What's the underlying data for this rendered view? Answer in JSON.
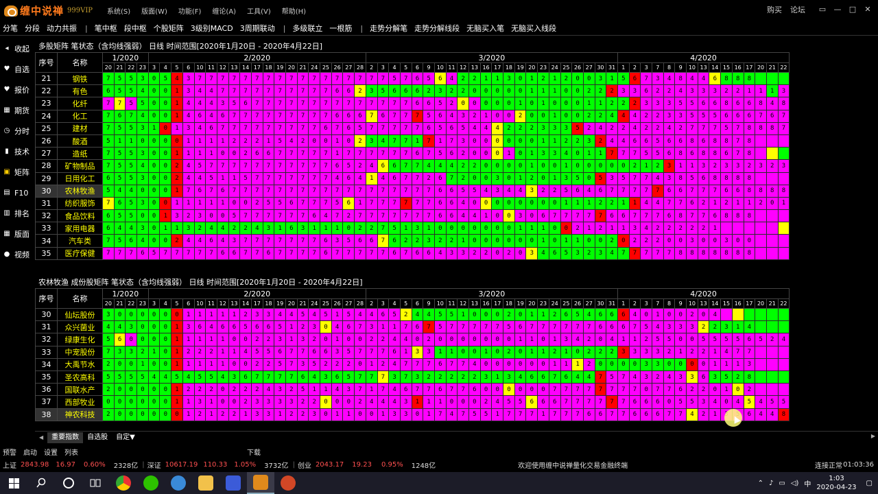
{
  "app": {
    "name": "缠中说禅",
    "edition": "999VIP",
    "menu": [
      "系统(S)",
      "版面(W)",
      "功能(F)",
      "缠论(A)",
      "工具(V)",
      "帮助(H)"
    ],
    "top_right": [
      "购买",
      "论坛"
    ],
    "window_buttons": [
      "▭",
      "—",
      "□",
      "✕"
    ]
  },
  "toolbar": {
    "items": [
      "分笔",
      "分段",
      "动力共振",
      "|",
      "笔中枢",
      "段中枢",
      "个股矩阵",
      "3级别MACD",
      "3周期联动",
      "|",
      "多级联立",
      "一根筋",
      "|",
      "走势分解笔",
      "走势分解线段",
      "无脑买入笔",
      "无脑买入线段"
    ]
  },
  "sidebar": {
    "items": [
      {
        "icon": "◂",
        "icon_name": "collapse-icon",
        "label": "收起"
      },
      {
        "icon": "♥",
        "icon_name": "favorite-icon",
        "label": "自选"
      },
      {
        "icon": "♥",
        "icon_name": "quote-icon",
        "label": "报价"
      },
      {
        "icon": "▦",
        "icon_name": "futures-icon",
        "label": "期货"
      },
      {
        "icon": "◷",
        "icon_name": "intraday-icon",
        "label": "分时"
      },
      {
        "icon": "▮",
        "icon_name": "technical-icon",
        "label": "技术"
      },
      {
        "icon": "▣",
        "icon_name": "matrix-icon",
        "label": "矩阵"
      },
      {
        "icon": "▤",
        "icon_name": "f10-icon",
        "label": "F10"
      },
      {
        "icon": "▥",
        "icon_name": "ranking-icon",
        "label": "排名"
      },
      {
        "icon": "▦",
        "icon_name": "layout-icon",
        "label": "版面"
      },
      {
        "icon": "●",
        "icon_name": "video-icon",
        "label": "视频"
      }
    ],
    "active_index": 6
  },
  "colors": {
    "g": "#00ff00",
    "m": "#ff00ff",
    "y": "#ffff00",
    "r": "#ff0000"
  },
  "matrix": {
    "months": [
      {
        "label": "1/2020",
        "span": 4
      },
      {
        "label": "2/2020",
        "span": 19
      },
      {
        "label": "3/2020",
        "span": 22
      },
      {
        "label": "4/2020",
        "span": 15
      }
    ],
    "days": [
      "20",
      "21",
      "22",
      "23",
      "3",
      "4",
      "5",
      "6",
      "10",
      "11",
      "12",
      "13",
      "14",
      "17",
      "18",
      "19",
      "20",
      "21",
      "24",
      "25",
      "26",
      "27",
      "28",
      "2",
      "3",
      "4",
      "5",
      "6",
      "9",
      "10",
      "11",
      "12",
      "13",
      "16",
      "17",
      "18",
      "19",
      "20",
      "23",
      "24",
      "25",
      "26",
      "27",
      "30",
      "31",
      "1",
      "2",
      "3",
      "7",
      "8",
      "9",
      "10",
      "13",
      "14",
      "15",
      "16",
      "17",
      "20",
      "21",
      "22"
    ],
    "header_seq": "序号",
    "header_name": "名称"
  },
  "panel1": {
    "title": "多股矩阵 笔状态（含均线强弱）  日线  时间范围[2020年1月20日 - 2020年4月22日]",
    "rows": [
      {
        "seq": "21",
        "name": "钢铁",
        "d": "755305437777777777777777757656422113012120031567348446888"
      },
      {
        "seq": "22",
        "name": "有色",
        "d": "655400134477777777776623566623220000011100222336224333221113"
      },
      {
        "seq": "23",
        "name": "化纤",
        "d": "775500144435677777777777777665200000101000112223335566866848"
      },
      {
        "seq": "24",
        "name": "化工",
        "d": "767400146467777777776667677756432100200100224442233555666767"
      },
      {
        "seq": "25",
        "name": "建材",
        "d": "755310134677777777767657777765654442223335242242242777578887888"
      },
      {
        "seq": "26",
        "name": "酸酒",
        "d": "511000011112221542001023477171730000001122324466566868878"
      },
      {
        "seq": "27",
        "name": "造纸",
        "d": "755300111100266777771777777675620001013340117775568688678"
      },
      {
        "seq": "28",
        "name": "矿物制品",
        "d": "755400245777777777776524667744422000010010000021231132332323"
      },
      {
        "seq": "29",
        "name": "日用化工",
        "d": "655300244511577777774641467726720030120135053577438568888"
      },
      {
        "seq": "30",
        "name": "农林牧渔",
        "d": "544000176767777777777777777776655434432256467777766777668888"
      },
      {
        "seq": "31",
        "name": "纺织服饰",
        "d": "765300111110025567775617777776640000000011122114477621211201"
      },
      {
        "seq": "32",
        "name": "食品饮料",
        "d": "655001323005777777647277777776644100306777776677768776888"
      },
      {
        "seq": "33",
        "name": "家用电器",
        "d": "644301132442243163111022751310000000111002121134222221"
      },
      {
        "seq": "34",
        "name": "汽车类",
        "d": "756400244643777777763566762232210000001011002022200300300"
      },
      {
        "seq": "35",
        "name": "医疗保健",
        "d": "777657777766776777767777767664332202034653234777778888888"
      }
    ],
    "colors": [
      "ggggggrmmmmmmmmmmmmmmmmmmmmmmymgggggggggggggggrmmmmmmyggggggggg",
      "ggggggrmmmmmmmmmmmmmmmygggggggggggggggggggggrmmmmmmmmmmmmmgmmmmmm",
      "mymgggrmmmmmmmmmmmmmmmmmmmmmmmmymgggggggggggggrmmmmmmmmmmmmmmmyg",
      "ggggggrmmmmmmmmmmmmmmmmymmmrmmmmmmmmyggggggggrmmmmmmmmmmmmmmmmmmm",
      "gggggrmmmmmmmmmmmmmmmmmmmmmmmmmmmmyggggggrmmmmmmmmmmmmmmmmmmmmmmmm",
      "ggggggrmmmmmmmmmmmmmmmygggggrmmmmmyggggggggrmmmmmmmmmmmmmmmmmmygg",
      "ggggggrmmmmmmmmmmmmmmmmmmmmmmmmmmmymggggggggrmmmmmmmmmmmmmyggggggggg",
      "ggggggrmmmmmmmmmmmmmmmmmyggggggggggggggggggggggggrmmmmmmmmmmyggggggggg",
      "ggggggrmmmmmmmmmmmmmmmmymmmmmmgggggggggggggrmmmmmmmmmmmmmmmmmymmmmrmmm",
      "ggggggrmmmmmmmmmmmmmmmmmmmmmmmmmmmmmmymmmmmmmmmmrmmmmmmmmmmmmmmmmrmmm",
      "yggggrmmmmmmmmmmmmmmmymmmmrmmmmmmyggggggggggggrmmmmmmmmmmmmmyggggggg",
      "gggggrmmmmmmmmmmmmmmmmmmmmmmmmmmmmmymmmmmmmrmmmmmmmmmmmmmmmmmmmmmmmm",
      "ggggggggggggggggggggggggggggggggggggggggrmmmmmmmmmmmmmmmmmmymmmmmmm",
      "ggggggrmmmmmmmmmmmmmmmmmyggggggggggggggggggggrmmmmmmmmmmmmmmmmmmmmm",
      "mmmmmmmmmmmmmmmmmmmmmmmmmmmmmmmmmmmmmyggggggggrmmmmmmmmmmmmmmmmmyg"
    ],
    "selected_seq": "30"
  },
  "panel2": {
    "title": "农林牧渔 成份股矩阵 笔状态（含均线强弱）  日线  时间范围[2020年1月20日 - 2020年4月22日]",
    "rows": [
      {
        "seq": "30",
        "name": "仙坛股份",
        "d": "300000011111233445451544652445510002011265466640100204"
      },
      {
        "seq": "31",
        "name": "众兴菌业",
        "d": "443000136466566512304673117675777775677777766675433322314"
      },
      {
        "seq": "32",
        "name": "绿康生化",
        "d": "560000111110022313201002244020000000110134204112550055556524"
      },
      {
        "seq": "33",
        "name": "中宠股份",
        "d": "733210122211455677663577761331100102011210222333321221477"
      },
      {
        "seq": "34",
        "name": "大禹节水",
        "d": "200100111110022573522201247776774000000111200003300001113"
      },
      {
        "seq": "35",
        "name": "圣农高科",
        "d": "555544545543677776436577737322222313466764475743243363528"
      },
      {
        "seq": "36",
        "name": "国联水产",
        "d": "200000122202224325114371746776776000000777777770776220102"
      },
      {
        "seq": "37",
        "name": "西部牧业",
        "d": "000000113100233332200024443111000245566677777766605534045455"
      },
      {
        "seq": "38",
        "name": "神农科技",
        "d": "200000012122133122301100133017475517771777667766677421356448"
      }
    ],
    "colors": [
      "ggggggrmmmmmmmmmmmmmmmmmmmyggggggggggggggggggrmmmmmmmmmyggggggggg",
      "ggggggrmmmmmmmmmmmmymmmmmmmmrmmmmmmmmmmmmmmmmmmmmmmmyggggggggggg",
      "gymgggrmmmmmmmmmmmmmmmmmmmmmmmmmmmmmmmmmmmmmmmmmmmmmmmmmmmmmmymm",
      "ggggggrmmmmmmmmmmmmmmmmmmmmymggggggggggggggggrmmmmmmmmmmmmmmmmmmmmyy",
      "ggggggrmmmmmmmmmmmmmmmmmmmmmmmmmmmmmmmmmmymggggggggrmmmmmmmmmmmmygg",
      "ggggggggggggggggggggggggyggggggggggggggggggrmmmmmmmymggggggggggggrmm",
      "ggggggrmmmmmmmmmmmmmmmmmmmmmmmmmmmmymmmmmmmrmmmmmmmmmmmymmmmmmmmmm",
      "ggggggrmmmmmmmmmmmmymmmmmmmrmmmmmmmmmymmmmmmrmmmmmmmmmmmymmmmmmrmmm",
      "ggggggrmmmmmmmmmmmmmmmmmmmmmmmmmmmmmmmmmmmmmmmmmmmmymmmmmmmrmmmmmm"
    ],
    "selected_seq": "38"
  },
  "tabs": {
    "items": [
      "重要指数",
      "自选股",
      "自定▼"
    ],
    "active_index": 0
  },
  "status1": [
    "预警",
    "启动",
    "设置",
    "列表"
  ],
  "status1_download": "下载",
  "ticker": {
    "sh_label": "上证",
    "sh_val": "2843.98",
    "sh_chg": "16.97",
    "sh_pct": "0.60%",
    "sh_amt": "2328亿",
    "sz_label": "深证",
    "sz_val": "10617.19",
    "sz_chg": "110.33",
    "sz_pct": "1.05%",
    "sz_amt": "3732亿",
    "cy_label": "创业",
    "cy_val": "2043.17",
    "cy_chg": "19.23",
    "cy_pct": "0.95%",
    "cy_amt": "1248亿",
    "welcome": "欢迎使用缠中说禅量化交易金融终端",
    "connection": "连接正常",
    "clock": "01:03:36"
  },
  "taskbar": {
    "time": "1:03",
    "date": "2020-04-23",
    "ime": "中"
  }
}
